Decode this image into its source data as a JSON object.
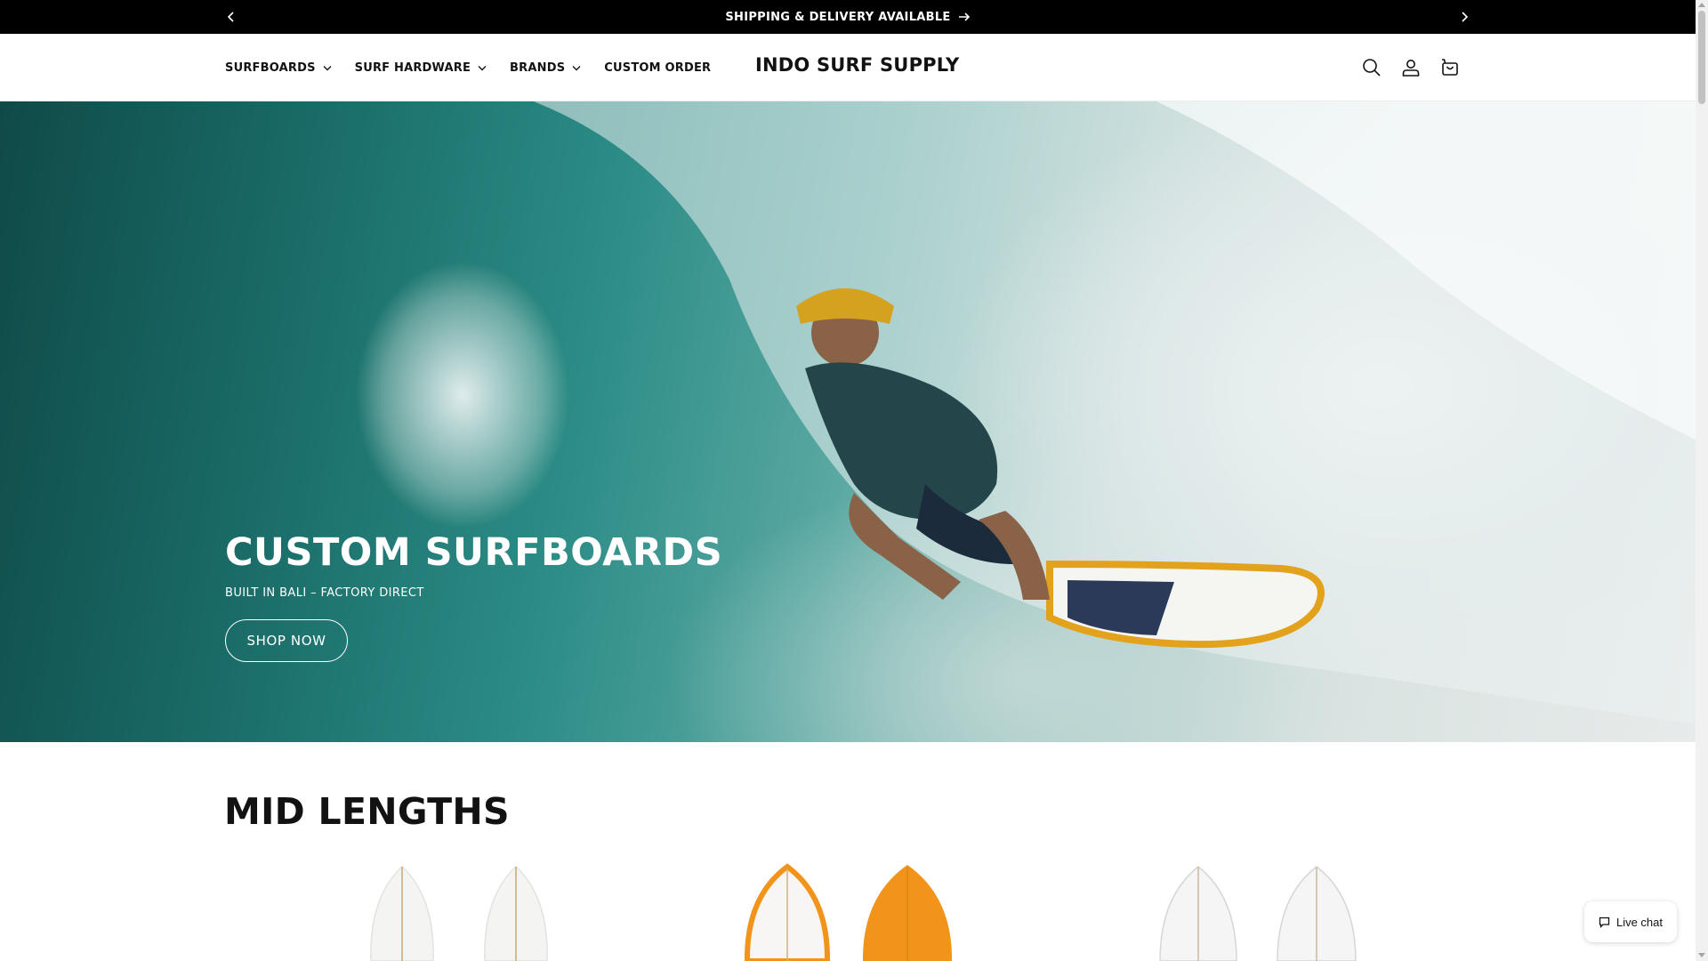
{
  "announcement": {
    "text": "SHIPPING & DELIVERY AVAILABLE",
    "prev_icon": "chevron-left-icon",
    "next_icon": "chevron-right-icon",
    "arrow_icon": "arrow-right-icon"
  },
  "header": {
    "logo": "INDO SURF SUPPLY",
    "nav": [
      {
        "label": "SURFBOARDS",
        "has_dropdown": true
      },
      {
        "label": "SURF HARDWARE",
        "has_dropdown": true
      },
      {
        "label": "BRANDS",
        "has_dropdown": true
      },
      {
        "label": "CUSTOM ORDER",
        "has_dropdown": false
      }
    ],
    "icons": [
      "search-icon",
      "account-icon",
      "cart-icon"
    ]
  },
  "hero": {
    "title": "CUSTOM SURFBOARDS",
    "subtitle": "BUILT IN BALI – FACTORY DIRECT",
    "button": "SHOP NOW"
  },
  "section": {
    "title": "MID LENGTHS",
    "products": [
      {
        "board_color": "#f4f4f2",
        "rail_color": "#e5e5e2",
        "stringer": "#c8a878"
      },
      {
        "board_color": "#f7f6f4",
        "rail_color": "#f2931a",
        "stringer": "#d0b080",
        "back_color": "#f2931a"
      },
      {
        "board_color": "#f5f5f5",
        "rail_color": "#dcdcdc",
        "stringer": "#cbb7a0"
      }
    ]
  },
  "live_chat": {
    "label": "Live chat",
    "icon": "chat-bubble-icon"
  },
  "colors": {
    "announce_bg": "#000000",
    "text": "#121212",
    "hero_teal": "#1a6c68"
  }
}
